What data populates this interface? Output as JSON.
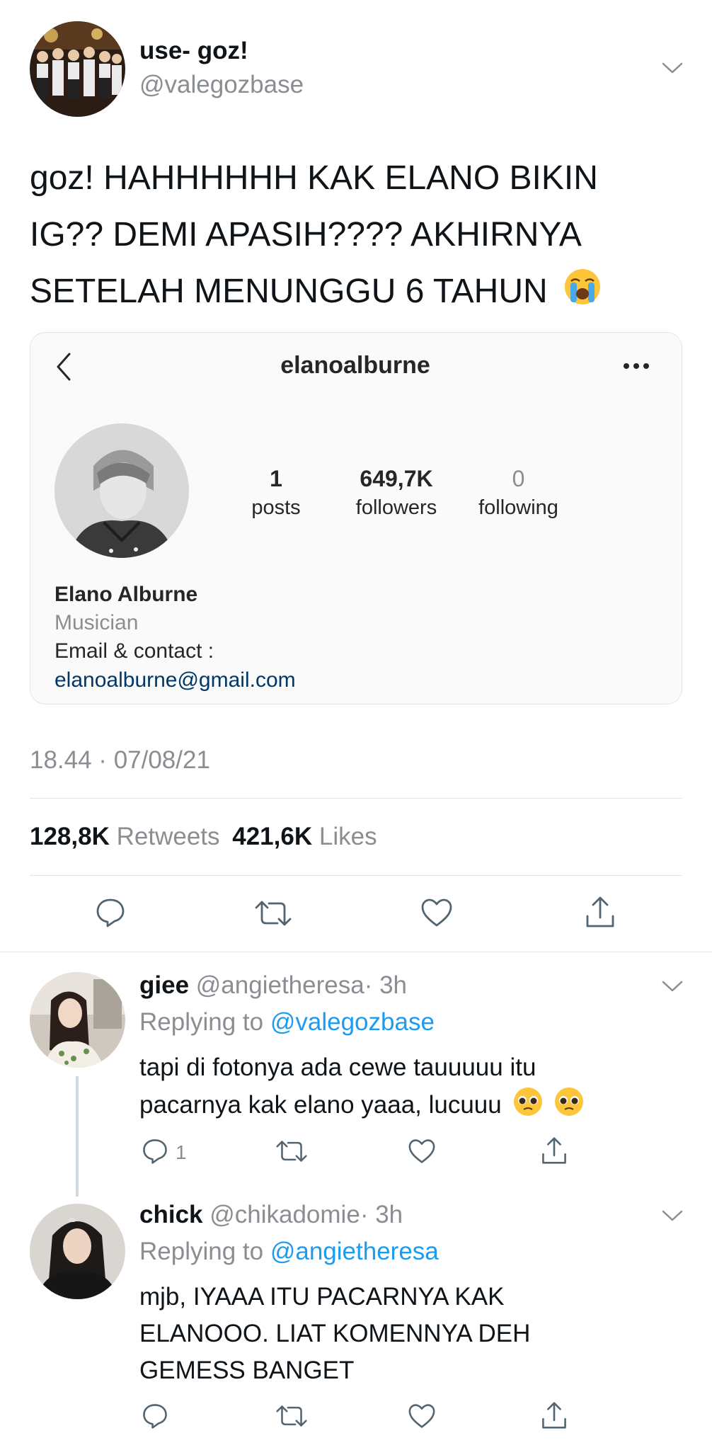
{
  "tweet": {
    "display_name": "use- goz!",
    "handle": "@valegozbase",
    "text": "goz! HAHHHHHH KAK ELANO BIKIN IG?? DEMI APASIH???? AKHIRNYA SETELAH MENUNGGU 6 TAHUN",
    "text_lines": [
      "goz! HAHHHHHH KAK ELANO BIKIN",
      "IG?? DEMI APASIH???? AKHIRNYA",
      "SETELAH MENUNGGU 6 TAHUN"
    ],
    "emoji": "loudly-crying-face",
    "timestamp": "18.44 · 07/08/21",
    "retweets_count": "128,8K",
    "retweets_label": "Retweets",
    "likes_count": "421,6K",
    "likes_label": "Likes"
  },
  "instagram_card": {
    "username": "elanoalburne",
    "posts_count": "1",
    "posts_label": "posts",
    "followers_count": "649,7K",
    "followers_label": "followers",
    "following_count": "0",
    "following_label": "following",
    "full_name": "Elano Alburne",
    "category": "Musician",
    "contact_label": "Email & contact :",
    "email": "elanoalburne@gmail.com"
  },
  "replies": [
    {
      "display_name": "giee",
      "handle": "@angietheresa",
      "time": "· 3h",
      "replying_prefix": "Replying to",
      "replying_handle": "@valegozbase",
      "text_lines": [
        "tapi di fotonya ada cewe tauuuuu itu",
        "pacarnya kak elano yaaa, lucuuu"
      ],
      "emoji": "pleading-face x2",
      "reply_count": "1"
    },
    {
      "display_name": "chick",
      "handle": "@chikadomie",
      "time": "· 3h",
      "replying_prefix": "Replying to",
      "replying_handle": "@angietheresa",
      "text_lines": [
        "mjb, IYAAA ITU PACARNYA KAK",
        "ELANOOO. LIAT KOMENNYA DEH",
        "GEMESS BANGET"
      ],
      "reply_count": ""
    }
  ],
  "colors": {
    "text": "#0f1419",
    "muted": "#8a8d91",
    "link": "#1d9bf0",
    "ig_link": "#00376b",
    "divider": "#e1e4e8",
    "card_bg": "#fafafa"
  }
}
